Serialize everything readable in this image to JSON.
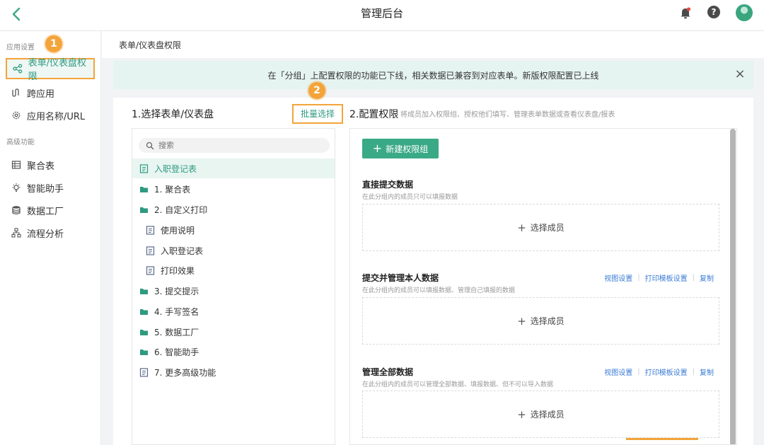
{
  "header": {
    "title": "管理后台"
  },
  "sidebar": {
    "section1_label": "应用设置",
    "items_settings": [
      "表单/仪表盘权限",
      "跨应用",
      "应用名称/URL"
    ],
    "section2_label": "高级功能",
    "items_advanced": [
      "聚合表",
      "智能助手",
      "数据工厂",
      "流程分析"
    ],
    "badge1": "1"
  },
  "breadcrumb": "表单/仪表盘权限",
  "notice": {
    "text": "在「分组」上配置权限的功能已下线，相关数据已兼容到对应表单。新版权限配置已上线"
  },
  "step1": {
    "title": "1.选择表单/仪表盘",
    "bulk_select": "批量选择",
    "badge2": "2"
  },
  "search": {
    "placeholder": "搜索"
  },
  "tree": [
    {
      "label": "入职登记表",
      "type": "form",
      "indent": 0
    },
    {
      "label": "1. 聚合表",
      "type": "folder",
      "indent": 0
    },
    {
      "label": "2. 自定义打印",
      "type": "folder",
      "indent": 0
    },
    {
      "label": "使用说明",
      "type": "form",
      "indent": 1
    },
    {
      "label": "入职登记表",
      "type": "form",
      "indent": 1
    },
    {
      "label": "打印效果",
      "type": "form",
      "indent": 1
    },
    {
      "label": "3. 提交提示",
      "type": "folder",
      "indent": 0
    },
    {
      "label": "4. 手写签名",
      "type": "folder",
      "indent": 0
    },
    {
      "label": "5. 数据工厂",
      "type": "folder",
      "indent": 0
    },
    {
      "label": "6. 智能助手",
      "type": "folder",
      "indent": 0
    },
    {
      "label": "7. 更多高级功能",
      "type": "form",
      "indent": 0
    }
  ],
  "step2": {
    "title": "2.配置权限",
    "desc": "将成员加入权限组、授权他们填写、管理表单数据或查看仪表盘/报表",
    "new_group": "新建权限组"
  },
  "groups": [
    {
      "title": "直接提交数据",
      "desc": "在此分组内的成员只可以填报数据",
      "select": "选择成员"
    },
    {
      "title": "提交并管理本人数据",
      "desc": "在此分组内的成员可以填报数据、管理自己填报的数据",
      "select": "选择成员",
      "actions": [
        "视图设置",
        "打印模板设置",
        "复制"
      ]
    },
    {
      "title": "管理全部数据",
      "desc": "在此分组内的成员可以管理全部数据、填报数据、但不可以导入数据",
      "select": "选择成员",
      "actions": [
        "视图设置",
        "打印模板设置",
        "复制"
      ]
    }
  ],
  "colors": {
    "accent": "#3aa985",
    "highlight": "#f3a43a",
    "link": "#3a7bd5",
    "notice_bg": "#e6f4f1"
  }
}
